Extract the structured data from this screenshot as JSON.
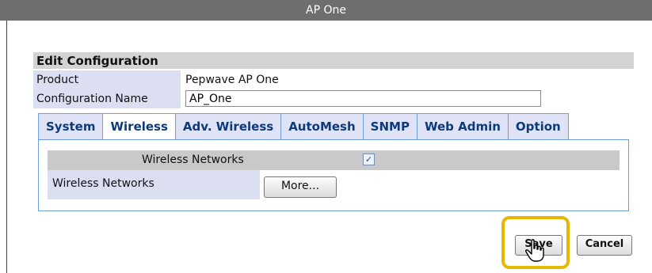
{
  "window": {
    "title": "AP One"
  },
  "config": {
    "header": "Edit Configuration",
    "product_label": "Product",
    "product_value": "Pepwave AP One",
    "name_label": "Configuration Name",
    "name_value": "AP_One"
  },
  "tabs": [
    {
      "label": "System"
    },
    {
      "label": "Wireless"
    },
    {
      "label": "Adv. Wireless"
    },
    {
      "label": "AutoMesh"
    },
    {
      "label": "SNMP"
    },
    {
      "label": "Web Admin"
    },
    {
      "label": "Option"
    }
  ],
  "wireless": {
    "header_label": "Wireless Networks",
    "enabled": true,
    "checkmark": "✓",
    "row_label": "Wireless Networks",
    "more_label": "More..."
  },
  "actions": {
    "save_label": "Save",
    "cancel_label": "Cancel"
  },
  "colors": {
    "highlight": "#e6b800",
    "tab_text": "#0d3a7a"
  }
}
